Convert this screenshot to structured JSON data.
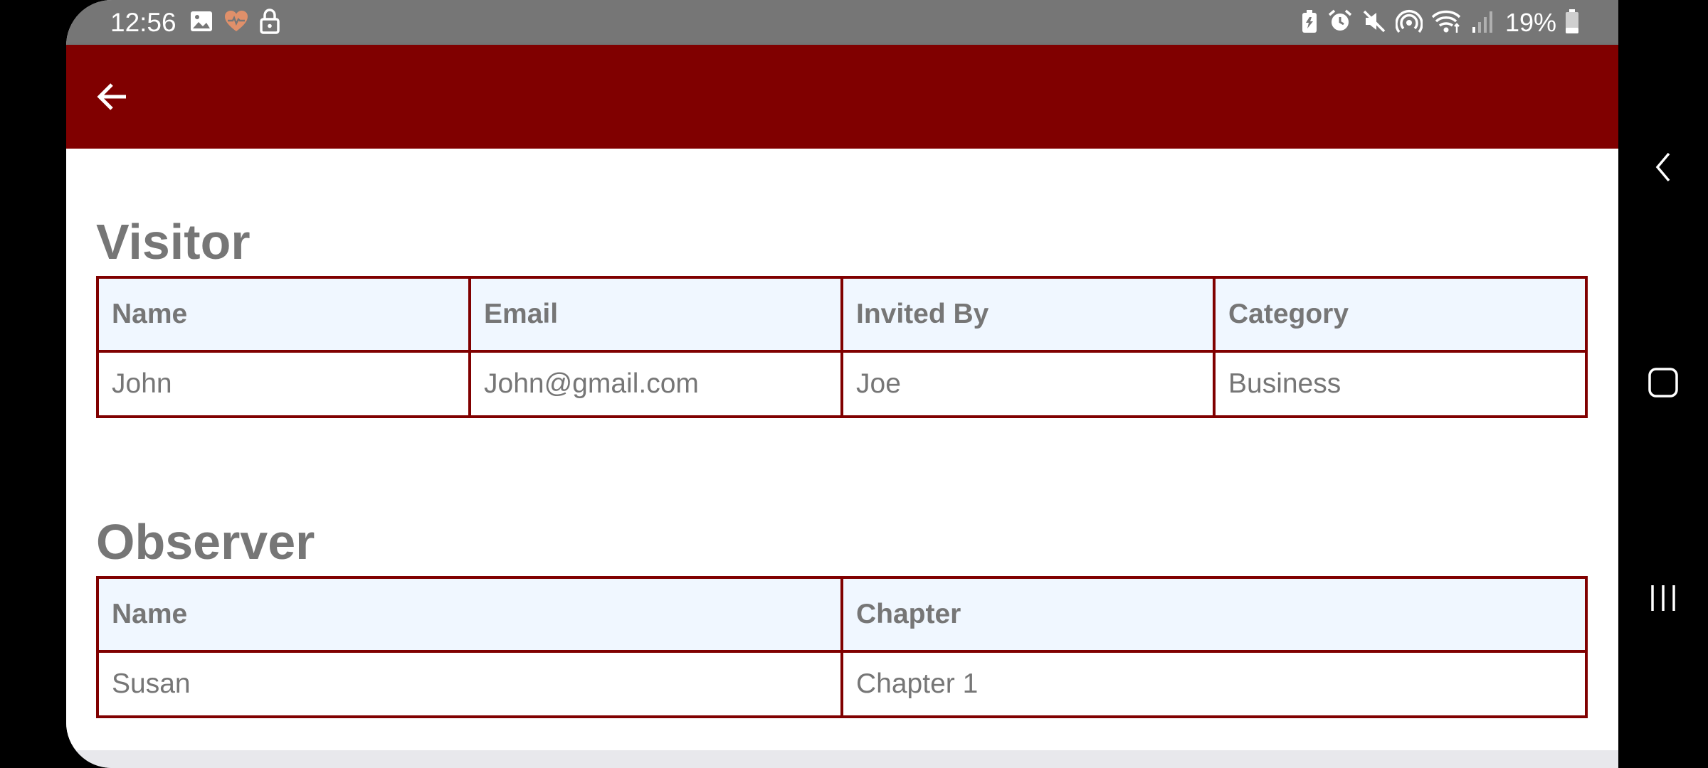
{
  "status_bar": {
    "time": "12:56",
    "battery_percent": "19%",
    "left_icons": [
      "image-icon",
      "health-heart-icon",
      "lock-icon"
    ],
    "right_icons": [
      "battery-saver-icon",
      "alarm-icon",
      "mute-icon",
      "hotspot-icon",
      "wifi-icon",
      "signal-icon",
      "battery-icon"
    ]
  },
  "colors": {
    "app_bar": "#800000",
    "status_bar": "#767676",
    "table_border": "#800000",
    "header_bg": "#f0f7ff",
    "text_gray": "#767676",
    "health_icon": "#e0906a"
  },
  "visitor": {
    "title": "Visitor",
    "columns": [
      "Name",
      "Email",
      "Invited By",
      "Category"
    ],
    "rows": [
      [
        "John",
        "John@gmail.com",
        "Joe",
        "Business"
      ]
    ]
  },
  "observer": {
    "title": "Observer",
    "columns": [
      "Name",
      "Chapter"
    ],
    "rows": [
      [
        "Susan",
        "Chapter 1"
      ]
    ]
  }
}
